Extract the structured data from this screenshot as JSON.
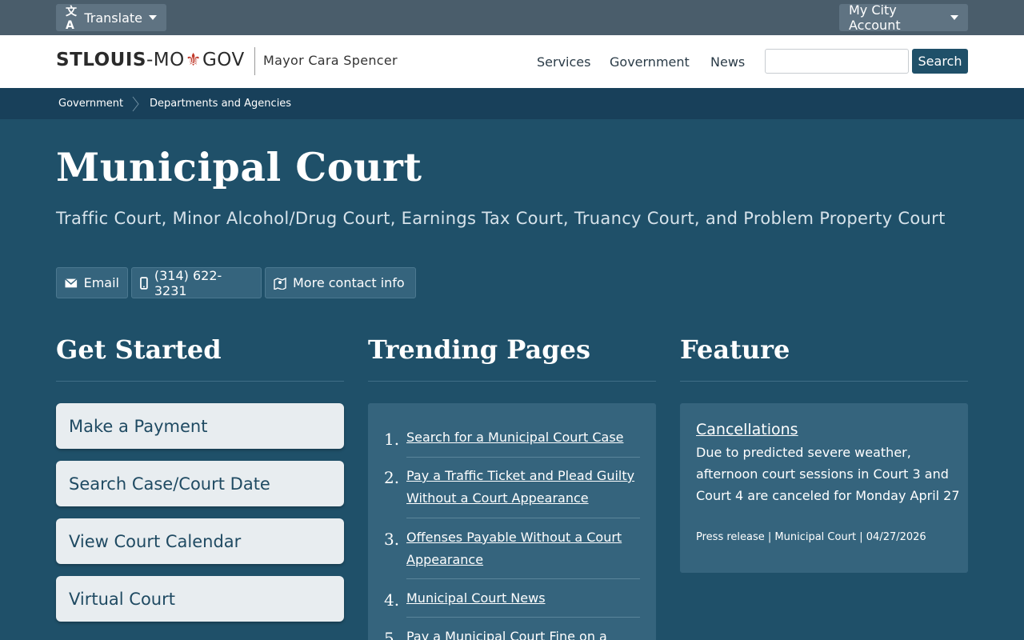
{
  "utility": {
    "translate_label": "Translate",
    "account_label": "My City Account"
  },
  "header": {
    "logo_part1": "STLOUIS",
    "logo_part2": "-MO",
    "logo_part3": "GOV",
    "mayor": "Mayor Cara Spencer",
    "nav": [
      "Services",
      "Government",
      "News"
    ],
    "search_placeholder": "",
    "search_button": "Search"
  },
  "breadcrumb": [
    "Government",
    "Departments and Agencies"
  ],
  "page": {
    "title": "Municipal Court",
    "subtitle": "Traffic Court, Minor Alcohol/Drug Court, Earnings Tax Court, Truancy Court, and Problem Property Court"
  },
  "contact": {
    "email": "Email",
    "phone": "(314) 622-3231",
    "more": "More contact info"
  },
  "get_started": {
    "title": "Get Started",
    "buttons": [
      "Make a Payment",
      "Search Case/Court Date",
      "View Court Calendar",
      "Virtual Court"
    ]
  },
  "trending": {
    "title": "Trending Pages",
    "items": [
      {
        "num": "1.",
        "label": "Search for a Municipal Court Case"
      },
      {
        "num": "2.",
        "label": "Pay a Traffic Ticket and Plead Guilty Without a Court Appearance"
      },
      {
        "num": "3.",
        "label": "Offenses Payable Without a Court Appearance"
      },
      {
        "num": "4.",
        "label": "Municipal Court News"
      },
      {
        "num": "5.",
        "label": "Pay a Municipal Court Fine on a"
      }
    ]
  },
  "feature": {
    "title": "Feature",
    "link": "Cancellations",
    "body": "Due to predicted severe weather, afternoon court sessions in Court 3 and Court 4 are canceled for Monday April 27",
    "meta": "Press release | Municipal Court | 04/27/2026"
  }
}
